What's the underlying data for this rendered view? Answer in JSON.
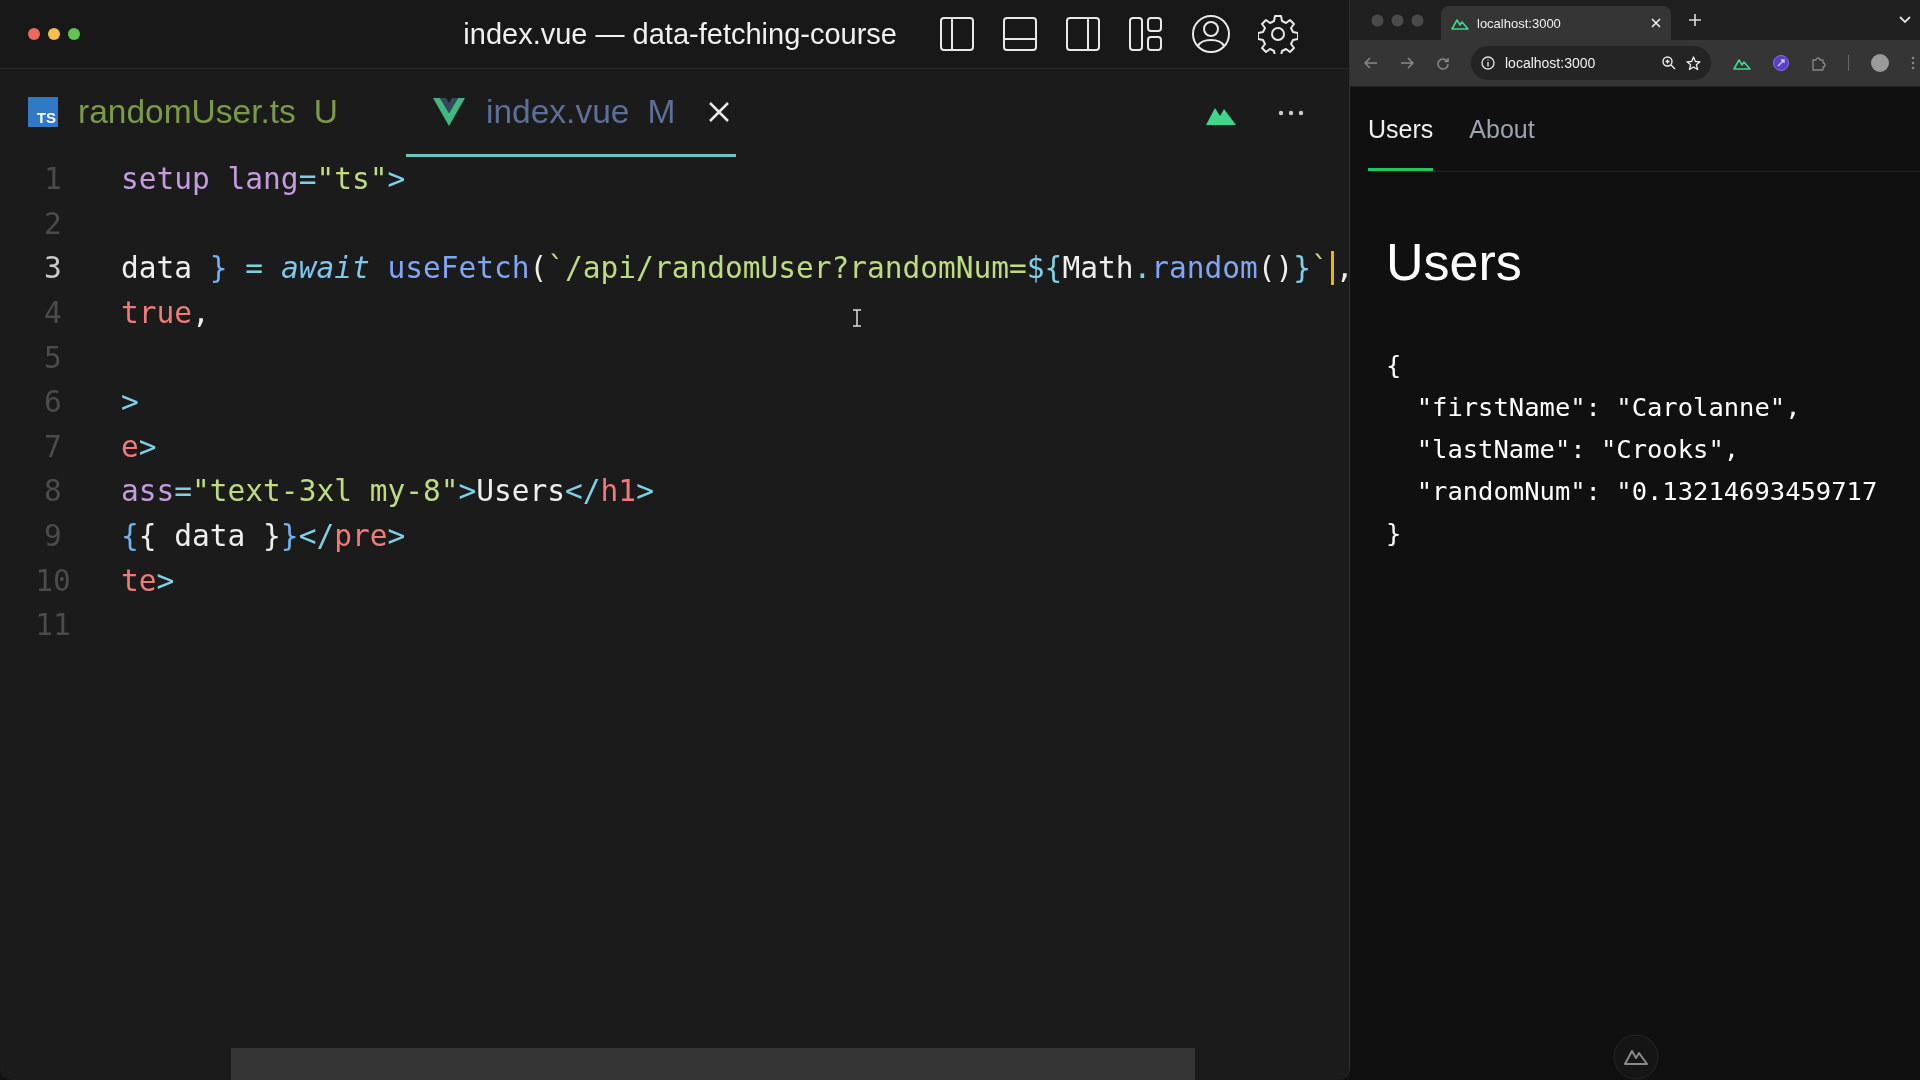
{
  "editor": {
    "title": "index.vue — data-fetching-course",
    "tabs": [
      {
        "label": "randomUser.ts",
        "badge": "U",
        "icon_label": "TS",
        "selected": false,
        "closable": false
      },
      {
        "label": "index.vue",
        "badge": "M",
        "selected": true,
        "closable": true
      }
    ],
    "lines": [
      {
        "number": "1",
        "current": false,
        "tokens": [
          {
            "text": "setup ",
            "kind": "attr"
          },
          {
            "text": "lang",
            "kind": "attr"
          },
          {
            "text": "=",
            "kind": "punct"
          },
          {
            "text": "\"ts\"",
            "kind": "string"
          },
          {
            "text": ">",
            "kind": "punct"
          }
        ]
      },
      {
        "number": "2",
        "current": false
      },
      {
        "number": "3",
        "current": true,
        "tokens": [
          {
            "text": "data ",
            "kind": "plain"
          },
          {
            "text": "}",
            "kind": "brace"
          },
          {
            "text": " = ",
            "kind": "punct"
          },
          {
            "text": "await",
            "kind": "keyword"
          },
          {
            "text": " useFetch",
            "kind": "func"
          },
          {
            "text": "(",
            "kind": "plain"
          },
          {
            "text": "`/api/randomUser?randomNum=",
            "kind": "string"
          },
          {
            "text": "${",
            "kind": "punct"
          },
          {
            "text": "Math",
            "kind": "plain"
          },
          {
            "text": ".",
            "kind": "punct"
          },
          {
            "text": "random",
            "kind": "func"
          },
          {
            "text": "()",
            "kind": "plain"
          },
          {
            "text": "}",
            "kind": "punct"
          },
          {
            "text": "`",
            "kind": "string"
          },
          {
            "kind": "caret"
          },
          {
            "text": ",",
            "kind": "plain"
          }
        ]
      },
      {
        "number": "4",
        "current": false,
        "tokens": [
          {
            "text": "true",
            "kind": "tag"
          },
          {
            "text": ",",
            "kind": "plain"
          }
        ]
      },
      {
        "number": "5",
        "current": false
      },
      {
        "number": "6",
        "current": false,
        "tokens": [
          {
            "text": ">",
            "kind": "punct"
          }
        ]
      },
      {
        "number": "7",
        "current": false,
        "tokens": [
          {
            "text": "e",
            "kind": "tag"
          },
          {
            "text": ">",
            "kind": "punct"
          }
        ]
      },
      {
        "number": "8",
        "current": false,
        "tokens": [
          {
            "text": "ass",
            "kind": "attr"
          },
          {
            "text": "=",
            "kind": "punct"
          },
          {
            "text": "\"text-3xl my-8\"",
            "kind": "string"
          },
          {
            "text": ">",
            "kind": "punct"
          },
          {
            "text": "Users",
            "kind": "plain"
          },
          {
            "text": "</",
            "kind": "punct"
          },
          {
            "text": "h1",
            "kind": "tag"
          },
          {
            "text": ">",
            "kind": "punct"
          }
        ]
      },
      {
        "number": "9",
        "current": false,
        "tokens": [
          {
            "text": "{",
            "kind": "brace"
          },
          {
            "text": "{ data }",
            "kind": "plain"
          },
          {
            "text": "}",
            "kind": "brace"
          },
          {
            "text": "</",
            "kind": "punct"
          },
          {
            "text": "pre",
            "kind": "tag"
          },
          {
            "text": ">",
            "kind": "punct"
          }
        ]
      },
      {
        "number": "10",
        "current": false,
        "tokens": [
          {
            "text": "te",
            "kind": "tag"
          },
          {
            "text": ">",
            "kind": "punct"
          }
        ]
      },
      {
        "number": "11",
        "current": false
      }
    ]
  },
  "browser": {
    "tab": {
      "title": "localhost:3000"
    },
    "url": "localhost:3000",
    "nav": [
      {
        "label": "Users",
        "selected": true
      },
      {
        "label": "About",
        "selected": false
      }
    ],
    "heading": "Users",
    "output": [
      "{",
      "  \"firstName\": \"Carolanne\",",
      "  \"lastName\": \"Crooks\",",
      "  \"randomNum\": \"0.13214693459717",
      "}"
    ]
  }
}
